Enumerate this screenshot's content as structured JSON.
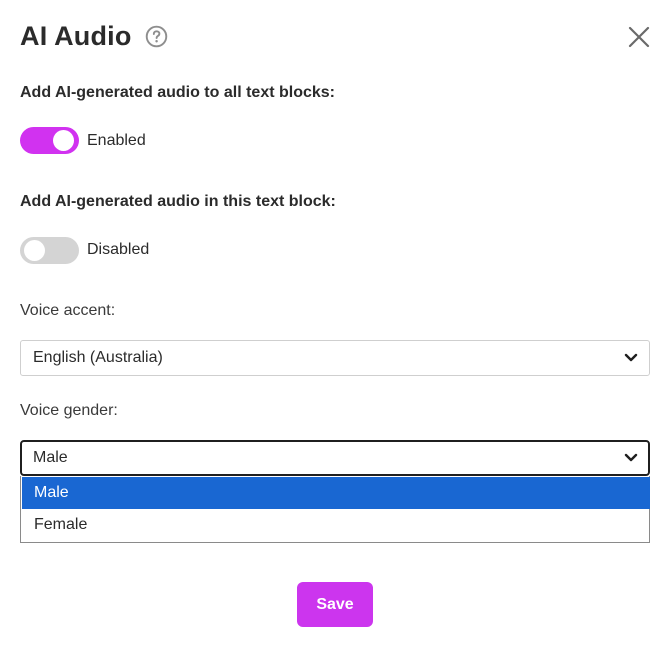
{
  "dialog": {
    "title": "AI Audio",
    "help_icon": "question-circle-icon",
    "close_icon": "close-x-icon"
  },
  "all_blocks": {
    "label": "Add AI-generated audio to all text blocks:",
    "state": "Enabled",
    "enabled": true
  },
  "this_block": {
    "label": "Add AI-generated audio in this text block:",
    "state": "Disabled",
    "enabled": false
  },
  "voice_accent": {
    "label": "Voice accent:",
    "value": "English (Australia)"
  },
  "voice_gender": {
    "label": "Voice gender:",
    "value": "Male",
    "options": [
      "Male",
      "Female"
    ],
    "highlighted": "Male"
  },
  "actions": {
    "save_label": "Save"
  },
  "colors": {
    "accent": "#d132f0",
    "save_button": "#cc35ee",
    "toggle_off": "#d4d4d4",
    "option_highlight": "#1967d2",
    "text": "#2b2b2b"
  }
}
